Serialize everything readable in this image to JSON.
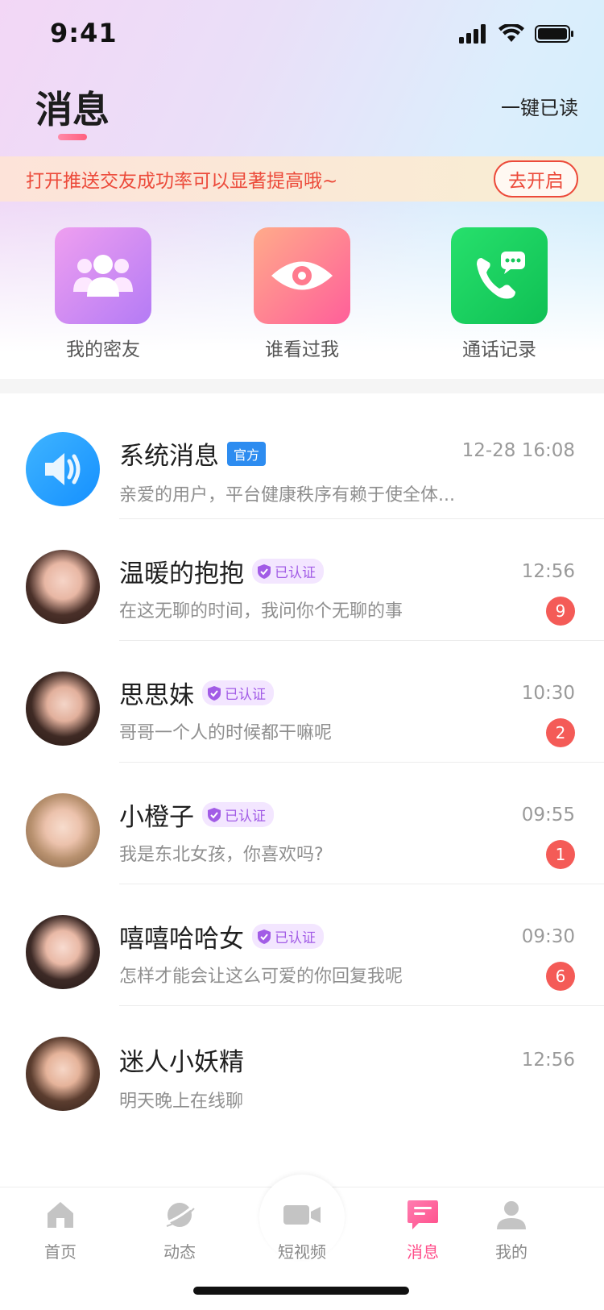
{
  "status_bar": {
    "time": "9:41"
  },
  "header": {
    "title": "消息",
    "mark_all_read": "一键已读"
  },
  "banner": {
    "text": "打开推送交友成功率可以显著提高哦~",
    "button": "去开启"
  },
  "quick_actions": [
    {
      "label": "我的密友",
      "icon": "group-icon"
    },
    {
      "label": "谁看过我",
      "icon": "eye-icon"
    },
    {
      "label": "通话记录",
      "icon": "phone-chat-icon"
    }
  ],
  "messages": [
    {
      "name": "系统消息",
      "badge": "官方",
      "time": "12-28 16:08",
      "preview": "亲爱的用户，平台健康秩序有赖于使全体...",
      "unread": ""
    },
    {
      "name": "温暖的抱抱",
      "badge": "已认证",
      "time": "12:56",
      "preview": "在这无聊的时间，我问你个无聊的事",
      "unread": "9"
    },
    {
      "name": "思思妹",
      "badge": "已认证",
      "time": "10:30",
      "preview": "哥哥一个人的时候都干嘛呢",
      "unread": "2"
    },
    {
      "name": "小橙子",
      "badge": "已认证",
      "time": "09:55",
      "preview": "我是东北女孩，你喜欢吗?",
      "unread": "1"
    },
    {
      "name": "嘻嘻哈哈女",
      "badge": "已认证",
      "time": "09:30",
      "preview": "怎样才能会让这么可爱的你回复我呢",
      "unread": "6"
    },
    {
      "name": "迷人小妖精",
      "badge": "",
      "time": "12:56",
      "preview": "明天晚上在线聊",
      "unread": ""
    }
  ],
  "tabbar": [
    {
      "label": "首页",
      "icon": "home-icon"
    },
    {
      "label": "动态",
      "icon": "planet-icon"
    },
    {
      "label": "短视频",
      "icon": "video-camera-icon"
    },
    {
      "label": "消息",
      "icon": "message-icon",
      "active": true
    },
    {
      "label": "我的",
      "icon": "person-icon"
    }
  ],
  "colors": {
    "accent": "#ff4f8b",
    "banner_red": "#ec4a3a",
    "official_blue": "#2d8cf0",
    "verified_purple": "#a25ce6",
    "unread_red": "#f45b57"
  }
}
